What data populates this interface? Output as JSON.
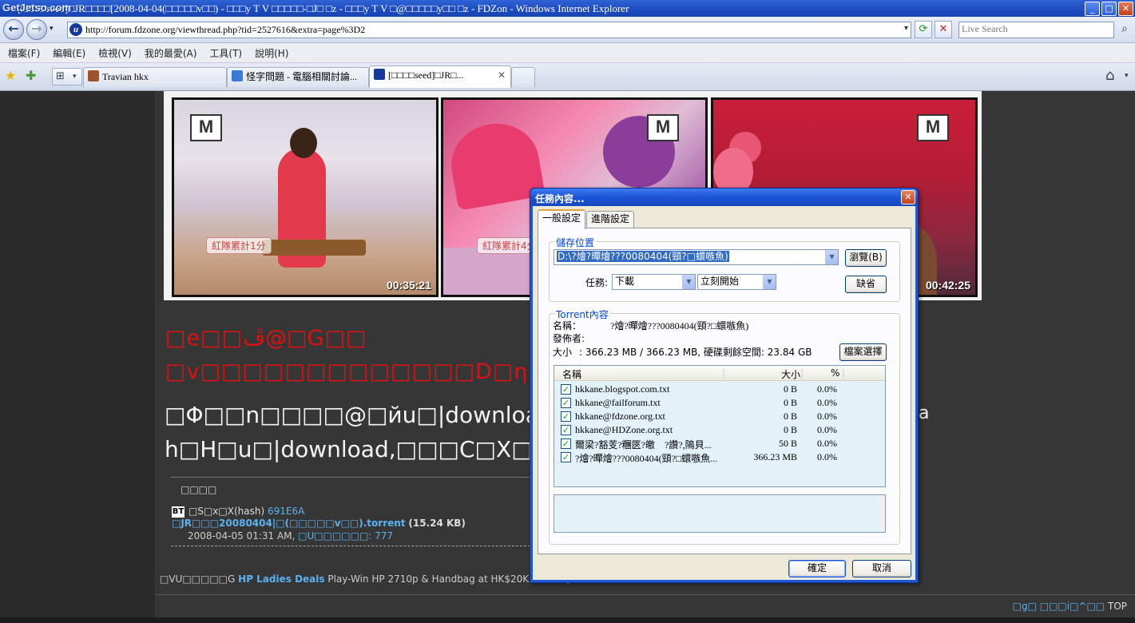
{
  "window": {
    "site_logo": "GetJetso.com",
    "title": "[□□□□seed]□JR□□□□[2008-04-04(□□□□□v□□) - □□□y T V □□□□□-□J□ □z - □□□y T V □@□□□□□y□□ □z - FDZon - Windows Internet Explorer",
    "minimize": "_",
    "maximize": "□",
    "close": "✕"
  },
  "address": {
    "back_icon": "←",
    "forward_icon": "→",
    "dropdown": "▾",
    "favicon": "u",
    "url": "http://forum.fdzone.org/viewthread.php?tid=2527616&extra=page%3D2",
    "refresh_icon": "⟳",
    "stop_icon": "✕",
    "search_placeholder": "Live Search",
    "search_icon": "⌕"
  },
  "menu": [
    "檔案(F)",
    "編輯(E)",
    "檢視(V)",
    "我的最愛(A)",
    "工具(T)",
    "說明(H)"
  ],
  "tabs": [
    {
      "label": "Travian hkx"
    },
    {
      "label": "怪字問題 - 電腦相關討論..."
    },
    {
      "label": "[□□□□seed]□JR□..."
    }
  ],
  "tab_close": "✕",
  "toolbar_icons": {
    "favorites": "★",
    "add_favorite": "✚",
    "quick_tabs": "⊞",
    "quick_tabs_dd": "▾",
    "home": "⌂",
    "home_dd": "▾"
  },
  "screenshots": [
    {
      "time": "00:35:21",
      "score": "紅隊累計1分"
    },
    {
      "time": "",
      "score": "紅隊累計4分"
    },
    {
      "time": "00:42:25",
      "score": ""
    }
  ],
  "post": {
    "red_line_1": "□e□□ڦ@□G□□",
    "red_line_2": "□v□□□□□□□□□□□□□D□ηN□□,",
    "white_line_1": "□Φ□□n□□□□@□йu□|download",
    "white_line_1_tail": "a",
    "white_line_2": "h□H□u□|download,□□□C□X□,",
    "attachments_header": "□□□□",
    "bt_badge": "BT",
    "hash_label": "□S□x□X(hash)",
    "hash_value": "691E6A",
    "torrent_name": "□JR□□□20080404|□(□□□□□v□□).torrent",
    "torrent_size": "(15.24 KB)",
    "date": "2008-04-05 01:31 AM,",
    "downloads": "□U□□□□□□: 777",
    "ad_prefix": "□VU□□□□□G",
    "ad_link": "HP Ladies Deals",
    "ad_text": "Play-Win HP 2710p & Handbag at HK$20K. www.hp",
    "footer_links": "□g□ □□□i□^□□",
    "footer_top": "TOP"
  },
  "dialog": {
    "title": "任務內容...",
    "close": "✕",
    "tab_general": "一般設定",
    "tab_advanced": "進階設定",
    "save_group": "儲存位置",
    "save_path": "D:\\?燴?暺燴???0080404(頸?□蠉嗾魚)",
    "browse_button": "瀏覽(B)",
    "task_label": "任務:",
    "task_value": "下載",
    "start_value": "立刻開始",
    "default_button": "缺省",
    "torrent_group": "Torrent內容",
    "name_label": "名稱：",
    "name_value": "?燴?暺燴???0080404(頸?□蠉嗾魚)",
    "publisher_label": "發佈者:",
    "size_label": "大小",
    "size_value": ": 366.23 MB / 366.23 MB, 硬碟剩餘空間: 23.84 GB",
    "file_select_button": "檔案選擇",
    "columns": {
      "name": "名稱",
      "size": "大小",
      "pct": "%"
    },
    "files": [
      {
        "name": "hkkane.blogspot.com.txt",
        "size": "0 B",
        "pct": "0.0%"
      },
      {
        "name": "hkkane@failforum.txt",
        "size": "0 B",
        "pct": "0.0%"
      },
      {
        "name": "hkkane@fdzone.org.txt",
        "size": "0 B",
        "pct": "0.0%"
      },
      {
        "name": "hkkane@HDZone.org.txt",
        "size": "0 B",
        "pct": "0.0%"
      },
      {
        "name": "爾梁?豁芰?糰匧?皦　?讚?,隝貝...",
        "size": "50 B",
        "pct": "0.0%"
      },
      {
        "name": "?燴?暺燴???0080404(頸?□蠉嗾魚...",
        "size": "366.23 MB",
        "pct": "0.0%"
      }
    ],
    "check_mark": "✓",
    "ok_button": "確定",
    "cancel_button": "取消"
  }
}
